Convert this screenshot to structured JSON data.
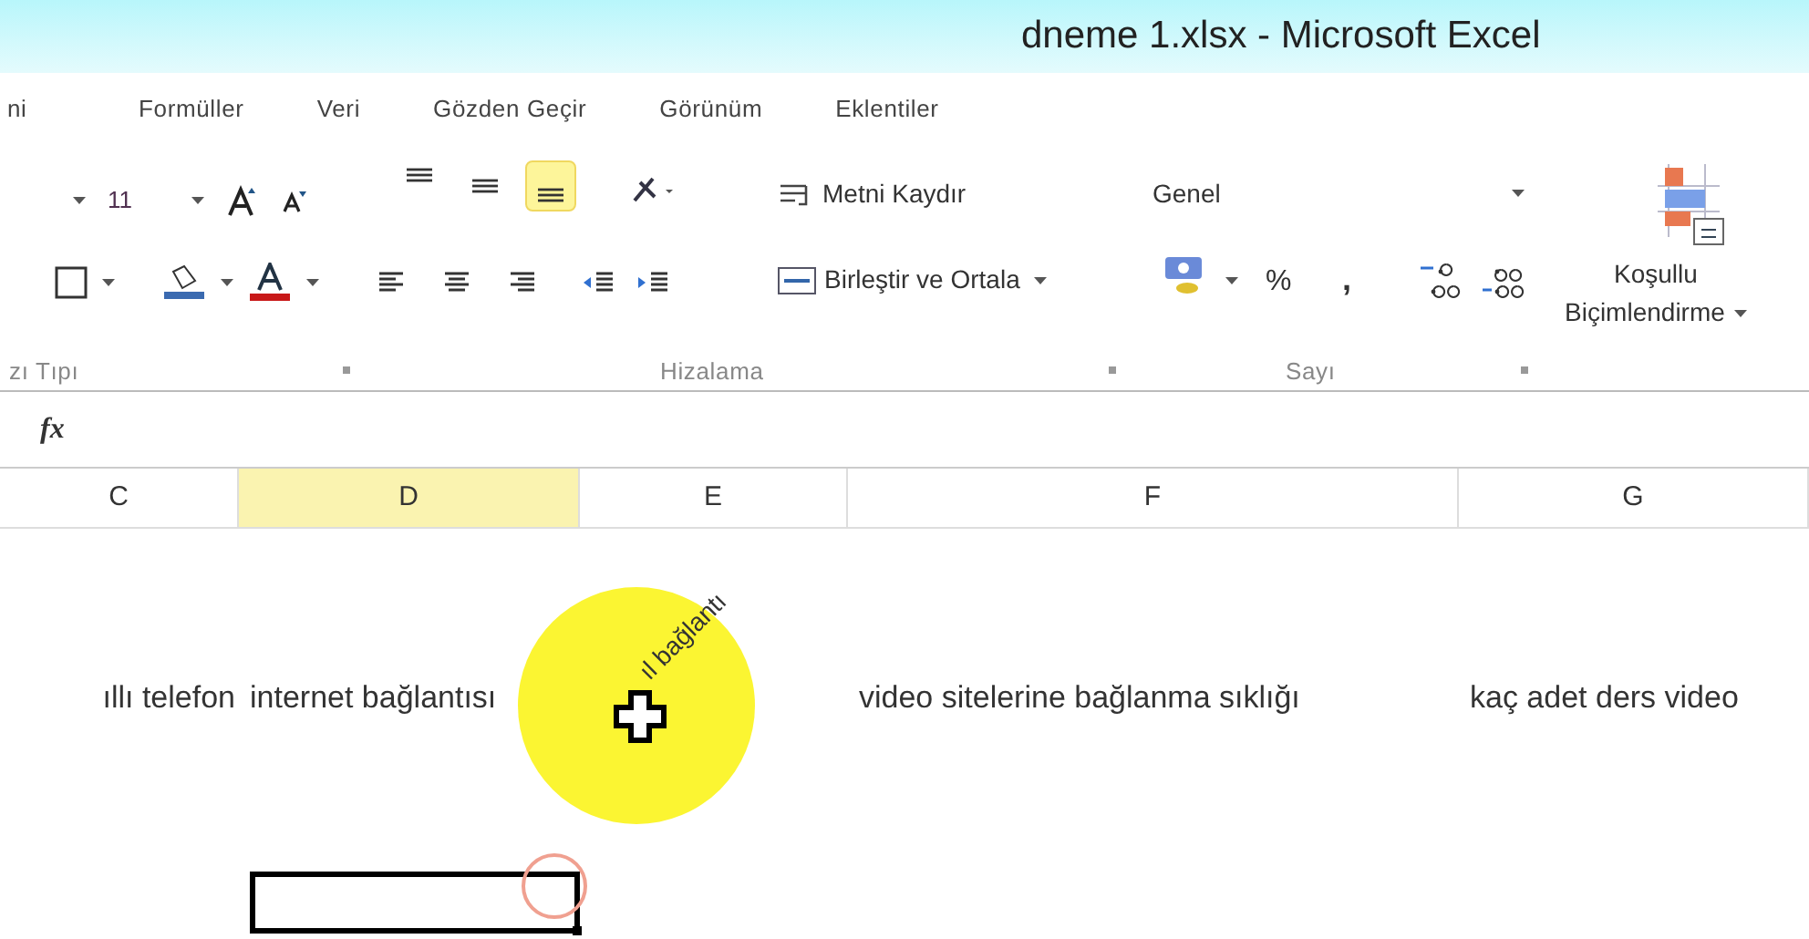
{
  "window": {
    "title": "dneme 1.xlsx  -  Microsoft Excel"
  },
  "tabs": [
    {
      "label": "ni",
      "selected": false
    },
    {
      "label": "Formüller",
      "selected": false
    },
    {
      "label": "Veri",
      "selected": false
    },
    {
      "label": "Gözden Geçir",
      "selected": false
    },
    {
      "label": "Görünüm",
      "selected": false
    },
    {
      "label": "Eklentiler",
      "selected": false
    }
  ],
  "ribbon": {
    "font_size": "11",
    "vertical_align": [
      {
        "selected": false
      },
      {
        "selected": false
      },
      {
        "selected": true
      }
    ],
    "wrap_text": "Metni Kaydır",
    "merge": "Birleştir ve Ortala",
    "number_format": "Genel",
    "percent": "%",
    "comma": ",",
    "conditional": [
      "Koşullu",
      "Biçimlendirme"
    ],
    "groups": [
      "zı Tıpı",
      "Hizalama",
      "Sayı"
    ]
  },
  "formula_bar": {
    "fx": "fx"
  },
  "columns": [
    {
      "label": "C",
      "selected": false
    },
    {
      "label": "D",
      "selected": true
    },
    {
      "label": "E",
      "selected": false
    },
    {
      "label": "F",
      "selected": false
    },
    {
      "label": "G",
      "selected": false
    }
  ],
  "rows": [
    {
      "cells": [
        "ıllı telefon",
        "internet bağlantısı",
        "ıl bağlantı",
        "video sitelerine bağlanma sıklığı",
        "kaç adet ders video"
      ]
    }
  ],
  "active_cell": {
    "shown": true
  }
}
